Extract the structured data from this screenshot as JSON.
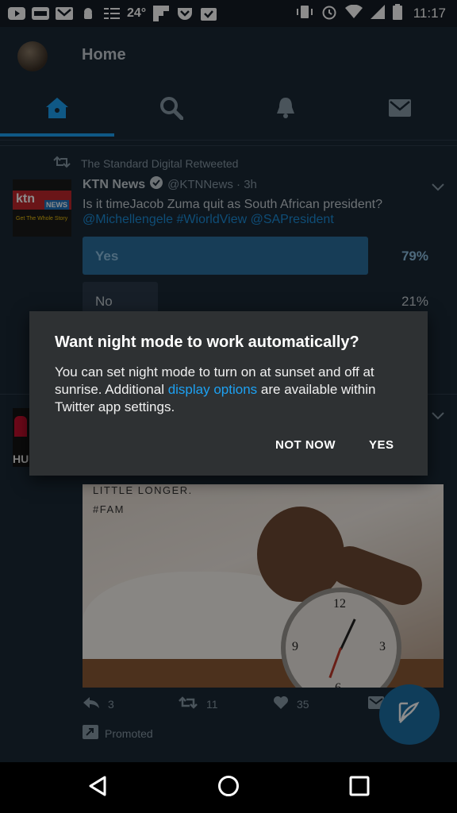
{
  "status_bar": {
    "temperature": "24°",
    "time": "11:17"
  },
  "header": {
    "title": "Home"
  },
  "tabs": [
    {
      "name": "home",
      "icon": "home-icon",
      "active": true
    },
    {
      "name": "search",
      "icon": "search-icon",
      "active": false
    },
    {
      "name": "notifications",
      "icon": "bell-icon",
      "active": false
    },
    {
      "name": "messages",
      "icon": "envelope-icon",
      "active": false
    }
  ],
  "tweet1": {
    "retweeted_by": "The Standard Digital Retweeted",
    "author_name": "KTN News",
    "handle_time": "@KTNNews · 3h",
    "text": "Is it timeJacob Zuma quit as South African president?",
    "links": "@Michellengele  #WiorldView @SAPresident",
    "logo_text": "ktn",
    "logo_badge": "NEWS",
    "logo_tagline": "Get The Whole Story",
    "poll": [
      {
        "label": "Yes",
        "percent": "79%",
        "fraction": 0.79
      },
      {
        "label": "No",
        "percent": "21%",
        "fraction": 0.21
      }
    ]
  },
  "tweet2": {
    "logo_text": "HU",
    "image_caption_line1": "LITTLE LONGER.",
    "image_caption_line2": "#FAM",
    "replies": "3",
    "retweets": "11",
    "likes": "35",
    "promoted": "Promoted"
  },
  "dialog": {
    "title": "Want night mode to work automatically?",
    "message_start": "You can set night mode to turn on at sunset and off at sunrise. Additional ",
    "message_link": "display options",
    "message_end": " are available within Twitter app settings.",
    "negative_button": "NOT NOW",
    "positive_button": "YES"
  },
  "colors": {
    "accent": "#1da1f2",
    "background": "#1b2836",
    "dialog": "#2e3133"
  }
}
